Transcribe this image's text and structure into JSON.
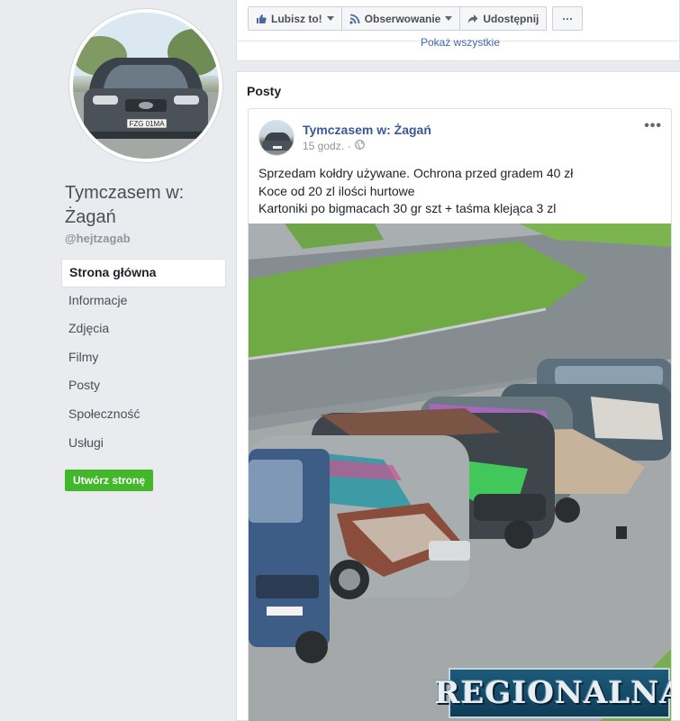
{
  "page": {
    "name": "Tymczasem w: Żagań",
    "handle": "@hejtzagab",
    "license_plate": "FZG 01MA"
  },
  "nav": {
    "items": [
      {
        "label": "Strona główna",
        "active": true
      },
      {
        "label": "Informacje"
      },
      {
        "label": "Zdjęcia"
      },
      {
        "label": "Filmy"
      },
      {
        "label": "Posty"
      },
      {
        "label": "Społeczność"
      },
      {
        "label": "Usługi"
      }
    ],
    "create_page": "Utwórz stronę"
  },
  "actions": {
    "like": "Lubisz to!",
    "follow": "Obserwowanie",
    "share": "Udostępnij",
    "more": "···",
    "show_all": "Pokaż wszystkie"
  },
  "posts": {
    "title": "Posty",
    "post": {
      "author": "Tymczasem w: Żagań",
      "time": "15 godz.",
      "menu": "•••",
      "lines": [
        "Sprzedam kołdry używane. Ochrona przed gradem 40 zł",
        "Koce od 20 zl ilości hurtowe",
        "Kartoniki po bigmacach 30 gr szt + taśma klejąca 3 zl"
      ],
      "photo_watermark": "REGIONALNA"
    }
  },
  "colors": {
    "link": "#385898",
    "green_button": "#42b72a",
    "background": "#e9ebee"
  },
  "icons": {
    "like": "thumbs-up-icon",
    "follow": "rss-icon",
    "share": "share-arrow-icon",
    "privacy": "globe-icon"
  }
}
